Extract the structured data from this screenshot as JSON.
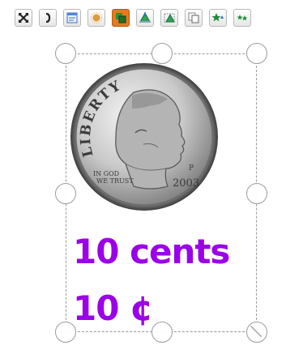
{
  "toolbar": {
    "buttons": [
      {
        "icon": "fit-to-page-icon"
      },
      {
        "icon": "bracket-icon"
      },
      {
        "icon": "properties-icon"
      },
      {
        "icon": "effects-icon"
      },
      {
        "icon": "arrange-icon"
      },
      {
        "icon": "shape-up-icon"
      },
      {
        "icon": "shape-down-icon"
      },
      {
        "icon": "duplicate-icon"
      },
      {
        "icon": "star-up-icon"
      },
      {
        "icon": "star-down-icon"
      }
    ]
  },
  "coin": {
    "motto": "LIBERTY",
    "in_god": "IN GOD",
    "we_trust": "WE TRUST",
    "mint_mark": "P",
    "year": "2003"
  },
  "captions": {
    "line1": "10 cents",
    "line2": "10 ¢"
  },
  "colors": {
    "caption": "#9b00e8",
    "frame": "#9a9a9a"
  }
}
